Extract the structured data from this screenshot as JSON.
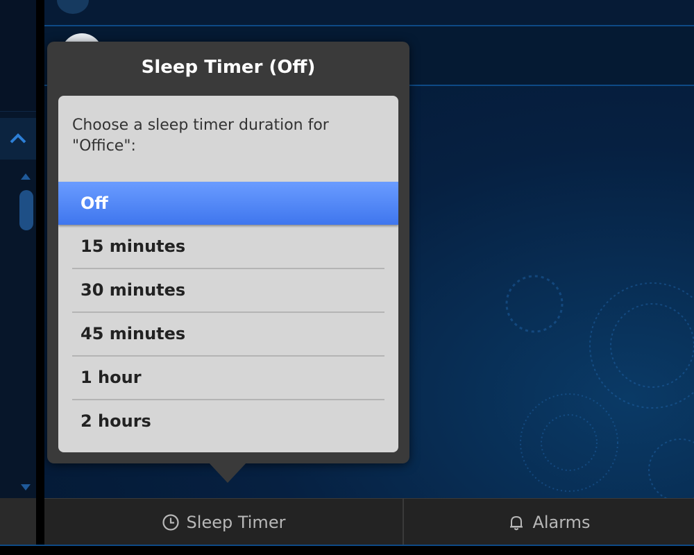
{
  "popover": {
    "title": "Sleep Timer (Off)",
    "prompt": "Choose a sleep timer duration for \"Office\":",
    "options": [
      {
        "label": "Off",
        "selected": true
      },
      {
        "label": "15 minutes",
        "selected": false
      },
      {
        "label": "30 minutes",
        "selected": false
      },
      {
        "label": "45 minutes",
        "selected": false
      },
      {
        "label": "1 hour",
        "selected": false
      },
      {
        "label": "2 hours",
        "selected": false
      }
    ]
  },
  "bottom_bar": {
    "sleep_timer_label": "Sleep Timer",
    "sleep_timer_icon": "clock-icon",
    "alarms_label": "Alarms",
    "alarms_icon": "bell-icon"
  },
  "colors": {
    "accent_selected": "#4a80f5",
    "background_dark": "#04182f",
    "popover_bg": "#3a3a3a",
    "list_bg": "#d6d6d6"
  }
}
